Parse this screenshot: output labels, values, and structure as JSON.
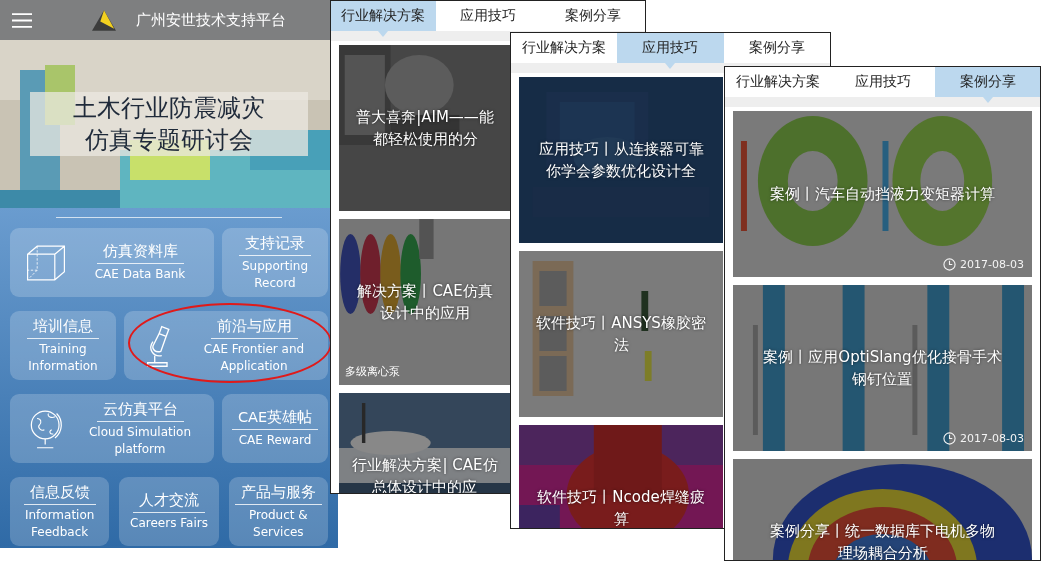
{
  "home": {
    "title": "广州安世技术支持平台",
    "banner": {
      "lines": [
        "土木行业防震减灾",
        "仿真专题研讨会"
      ]
    },
    "tile_rows": [
      {
        "tiles": [
          {
            "cn": "仿真资料库",
            "en": "CAE Data Bank",
            "kind": "wide",
            "highlighted": false
          },
          {
            "cn": "支持记录",
            "en": "Supporting Record",
            "kind": "narrow",
            "highlighted": false
          }
        ]
      },
      {
        "tiles": [
          {
            "cn": "培训信息",
            "en": "Training Information",
            "kind": "narrow",
            "highlighted": false
          },
          {
            "cn": "前沿与应用",
            "en": "CAE Frontier and Application",
            "kind": "wide",
            "highlighted": true
          }
        ]
      },
      {
        "tiles": [
          {
            "cn": "云仿真平台",
            "en": "Cloud Simulation platform",
            "kind": "wide",
            "highlighted": false
          },
          {
            "cn": "CAE英雄帖",
            "en": "CAE Reward",
            "kind": "narrow",
            "highlighted": false
          }
        ]
      },
      {
        "tiles": [
          {
            "cn": "信息反馈",
            "en": "Information Feedback",
            "kind": "third",
            "highlighted": false
          },
          {
            "cn": "人才交流",
            "en": "Careers Fairs",
            "kind": "third",
            "highlighted": false
          },
          {
            "cn": "产品与服务",
            "en": "Product & Services",
            "kind": "third",
            "highlighted": false
          }
        ]
      }
    ]
  },
  "article_screens": [
    {
      "tabs": [
        {
          "label": "行业解决方案",
          "selected": true
        },
        {
          "label": "应用技巧",
          "selected": false
        },
        {
          "label": "案例分享",
          "selected": false
        }
      ],
      "cards": [
        {
          "title_lines": [
            "普大喜奔|AIM——能",
            "都轻松使用的分"
          ]
        },
        {
          "title_lines": [
            "解决方案丨CAE仿真",
            "设计中的应用"
          ],
          "caption": "多级离心泵"
        },
        {
          "title_lines": [
            "行业解决方案| CAE仿",
            "总体设计中的应"
          ]
        }
      ]
    },
    {
      "tabs": [
        {
          "label": "行业解决方案",
          "selected": false
        },
        {
          "label": "应用技巧",
          "selected": true
        },
        {
          "label": "案例分享",
          "selected": false
        }
      ],
      "cards": [
        {
          "title_lines": [
            "应用技巧丨从连接器可靠",
            "你学会参数优化设计全"
          ]
        },
        {
          "title_lines": [
            "软件技巧丨ANSYS橡胶密",
            "法"
          ]
        },
        {
          "title_lines": [
            "软件技巧丨Ncode焊缝疲",
            "算"
          ]
        }
      ]
    },
    {
      "tabs": [
        {
          "label": "行业解决方案",
          "selected": false
        },
        {
          "label": "应用技巧",
          "selected": false
        },
        {
          "label": "案例分享",
          "selected": true
        }
      ],
      "cards": [
        {
          "title_lines": [
            "案例丨汽车自动挡液力变矩器计算"
          ],
          "date": "2017-08-03"
        },
        {
          "title_lines": [
            "案例丨应用OptiSlang优化接骨手术",
            "钢钉位置"
          ],
          "date": "2017-08-03"
        },
        {
          "title_lines": [
            "案例分享丨统一数据库下电机多物",
            "理场耦合分析"
          ]
        }
      ]
    }
  ]
}
